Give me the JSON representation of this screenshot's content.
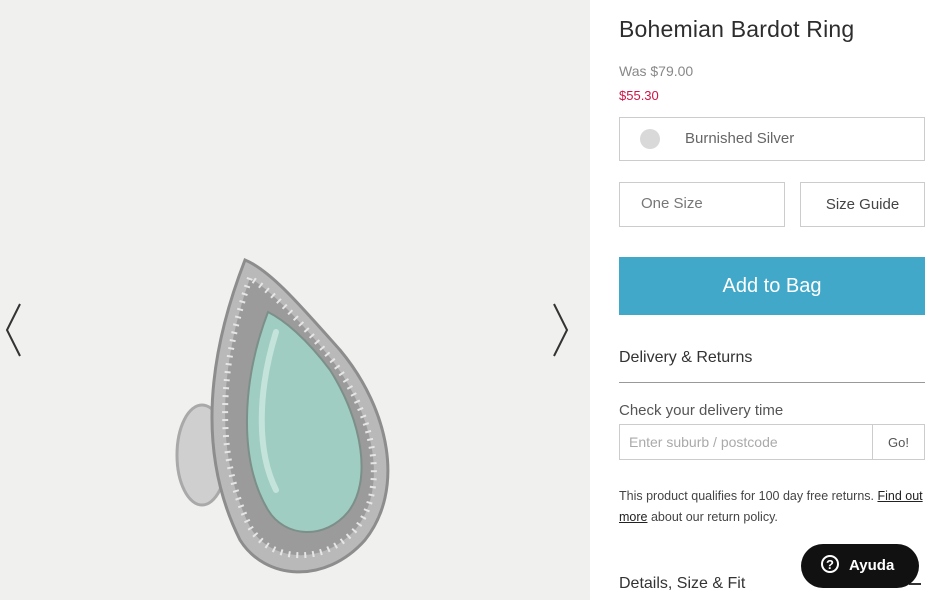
{
  "product": {
    "title": "Bohemian Bardot Ring",
    "was_price": "Was $79.00",
    "price": "$55.30"
  },
  "colors": {
    "accent": "#41a8c9",
    "sale": "#d01345",
    "swatch": "#d9d9d9"
  },
  "options": {
    "color_selected": "Burnished Silver",
    "size_selected": "One Size",
    "size_guide_label": "Size Guide"
  },
  "actions": {
    "add_to_bag": "Add to Bag"
  },
  "delivery": {
    "heading": "Delivery & Returns",
    "check_label": "Check your delivery time",
    "postcode_placeholder": "Enter suburb / postcode",
    "go_label": "Go!",
    "returns_text_1": "This product qualifies for 100 day free returns. ",
    "find_out_more": "Find out more",
    "returns_text_2": " about our return policy."
  },
  "details": {
    "heading": "Details, Size & Fit"
  },
  "help": {
    "label": "Ayuda",
    "icon_glyph": "?"
  },
  "icons": {
    "prev": "chevron-left-icon",
    "next": "chevron-right-icon",
    "help": "question-circle-icon"
  }
}
